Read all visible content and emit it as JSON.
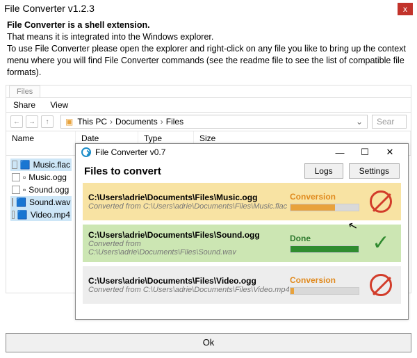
{
  "titlebar": {
    "title": "File Converter v1.2.3",
    "close": "x"
  },
  "intro": {
    "heading": "File Converter is a shell extension.",
    "line1": "That means it is integrated into the Windows explorer.",
    "line2": "To use File Converter please open the explorer and right-click on any file you like to bring up the context menu where you will find File Converter commands (see the readme file to see the list of compatible file formats)."
  },
  "explorer": {
    "tab": "Files",
    "menus": [
      "Share",
      "View"
    ],
    "breadcrumb": [
      "This PC",
      "Documents",
      "Files"
    ],
    "search_placeholder": "Sear",
    "columns": [
      "Name",
      "Date modified",
      "Type",
      "Size"
    ],
    "files": [
      {
        "name": "Music.flac",
        "selected": true,
        "kind": "audio"
      },
      {
        "name": "Music.ogg",
        "selected": false,
        "kind": "doc"
      },
      {
        "name": "Sound.ogg",
        "selected": false,
        "kind": "doc"
      },
      {
        "name": "Sound.wav",
        "selected": true,
        "kind": "audio"
      },
      {
        "name": "Video.mp4",
        "selected": true,
        "kind": "video"
      }
    ]
  },
  "converter": {
    "title": "File Converter v0.7",
    "heading": "Files to convert",
    "buttons": {
      "logs": "Logs",
      "settings": "Settings"
    },
    "jobs": [
      {
        "path": "C:\\Users\\adrie\\Documents\\Files\\Music.ogg",
        "src": "Converted from C:\\Users\\adrie\\Documents\\Files\\Music.flac",
        "status_label": "Conversion",
        "status_color": "orange",
        "bg": "yellow",
        "progress_pct": 65,
        "icon": "cancel"
      },
      {
        "path": "C:\\Users\\adrie\\Documents\\Files\\Sound.ogg",
        "src": "Converted from C:\\Users\\adrie\\Documents\\Files\\Sound.wav",
        "status_label": "Done",
        "status_color": "green",
        "bg": "green",
        "progress_pct": 100,
        "icon": "check"
      },
      {
        "path": "C:\\Users\\adrie\\Documents\\Files\\Video.ogg",
        "src": "Converted from C:\\Users\\adrie\\Documents\\Files\\Video.mp4",
        "status_label": "Conversion",
        "status_color": "orange",
        "bg": "grey",
        "progress_pct": 5,
        "icon": "cancel"
      }
    ]
  },
  "ok_button": "Ok"
}
